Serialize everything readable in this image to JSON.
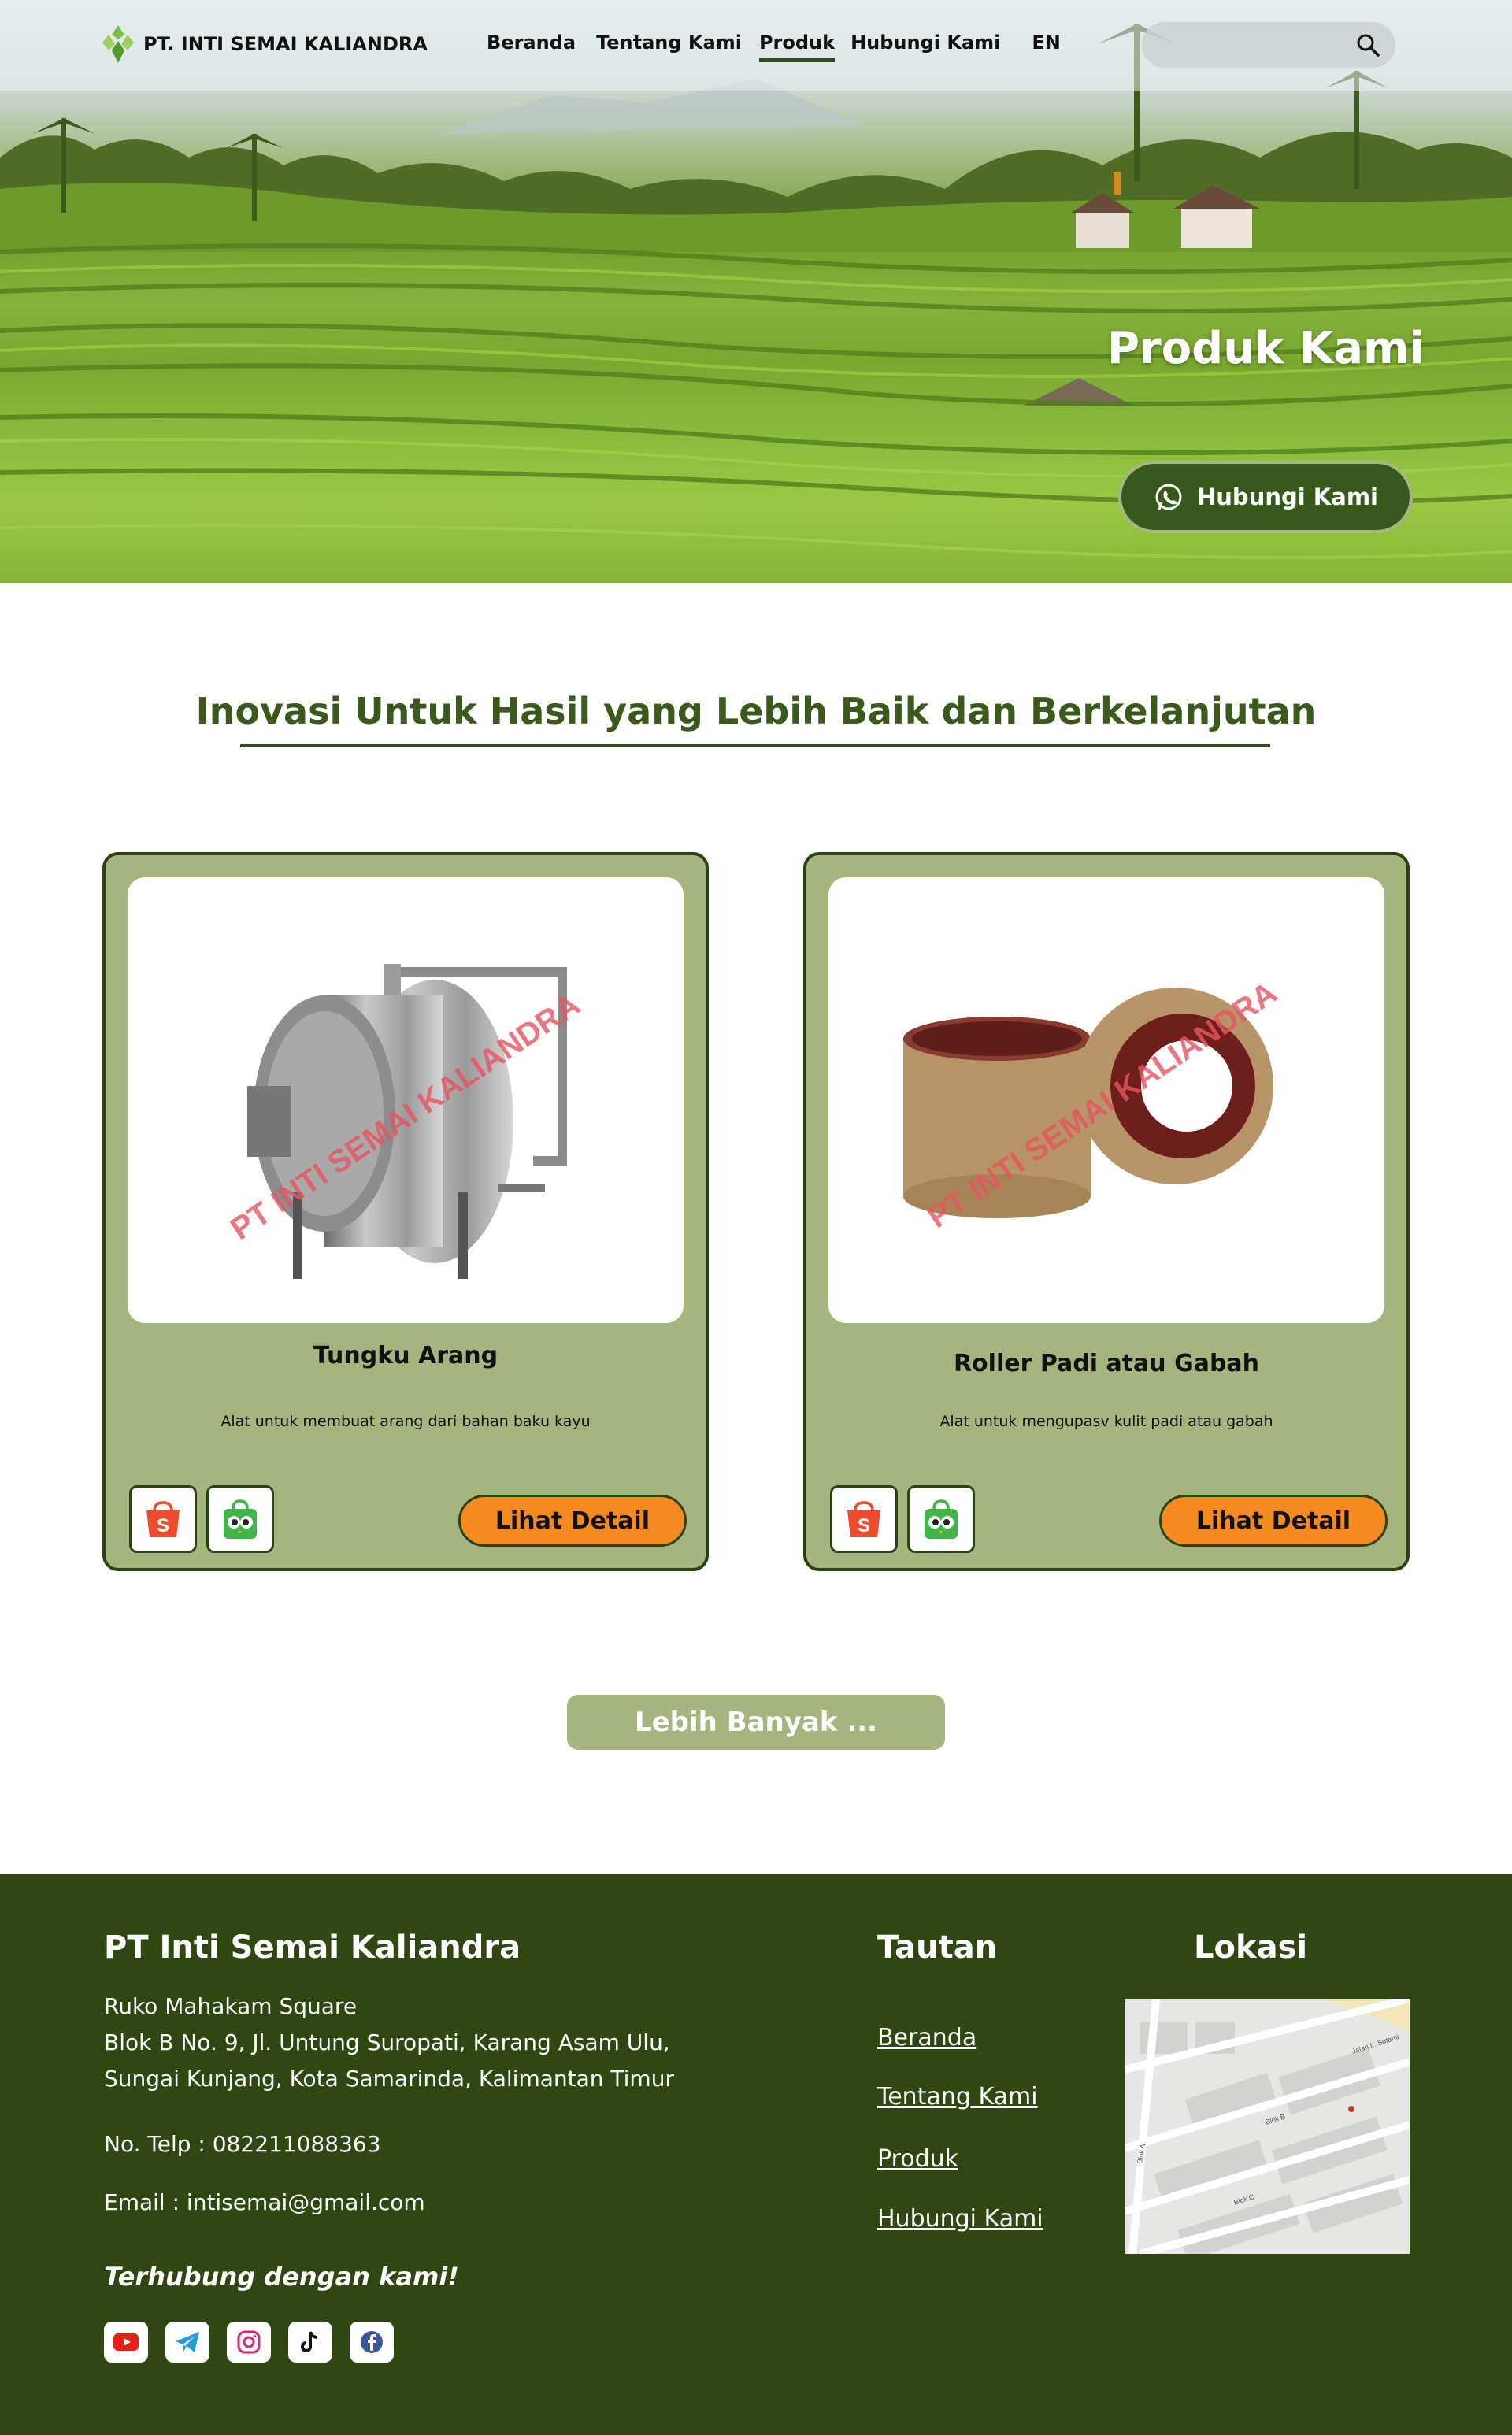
{
  "brand": {
    "name": "PT. INTI SEMAI KALIANDRA",
    "accent": "#3a5a1c",
    "card_bg": "#a6b57d",
    "cta_orange": "#f58a1f",
    "footer_bg": "#2f4811"
  },
  "nav": {
    "items": [
      "Beranda",
      "Tentang Kami",
      "Produk",
      "Hubungi Kami"
    ],
    "active": "Produk",
    "language": "EN",
    "search_placeholder": "",
    "search_icon": "search-icon"
  },
  "hero": {
    "title": "Produk Kami",
    "cta_label": "Hubungi Kami",
    "cta_icon": "whatsapp-icon"
  },
  "main": {
    "title": "Inovasi Untuk Hasil yang Lebih Baik dan Berkelanjutan",
    "watermark": "PT INTI SEMAI KALIANDRA",
    "products": [
      {
        "name": "Tungku Arang",
        "description": "Alat untuk membuat arang dari bahan baku kayu",
        "button": "Lihat Detail",
        "marketplaces": [
          "shopee-icon",
          "tokopedia-icon"
        ]
      },
      {
        "name": "Roller Padi atau Gabah",
        "description": "Alat untuk mengupasv kulit padi atau gabah",
        "button": "Lihat Detail",
        "marketplaces": [
          "shopee-icon",
          "tokopedia-icon"
        ]
      }
    ],
    "more_label": "Lebih Banyak ..."
  },
  "footer": {
    "company": "PT Inti Semai Kaliandra",
    "address_lines": [
      "Ruko Mahakam Square",
      "Blok B No. 9, Jl. Untung Suropati, Karang Asam Ulu,",
      "Sungai Kunjang, Kota Samarinda, Kalimantan Timur"
    ],
    "phone": "No. Telp : 082211088363",
    "email": "Email : intisemai@gmail.com",
    "connect": "Terhubung dengan kami!",
    "socials": [
      "youtube-icon",
      "telegram-icon",
      "instagram-icon",
      "tiktok-icon",
      "facebook-icon"
    ],
    "links_title": "Tautan",
    "links": [
      "Beranda",
      "Tentang Kami",
      "Produk",
      "Hubungi Kami"
    ],
    "location_title": "Lokasi",
    "map_labels": [
      "Jalan Ir. Sutami",
      "Blok B",
      "Blok C",
      "Blok A"
    ]
  }
}
